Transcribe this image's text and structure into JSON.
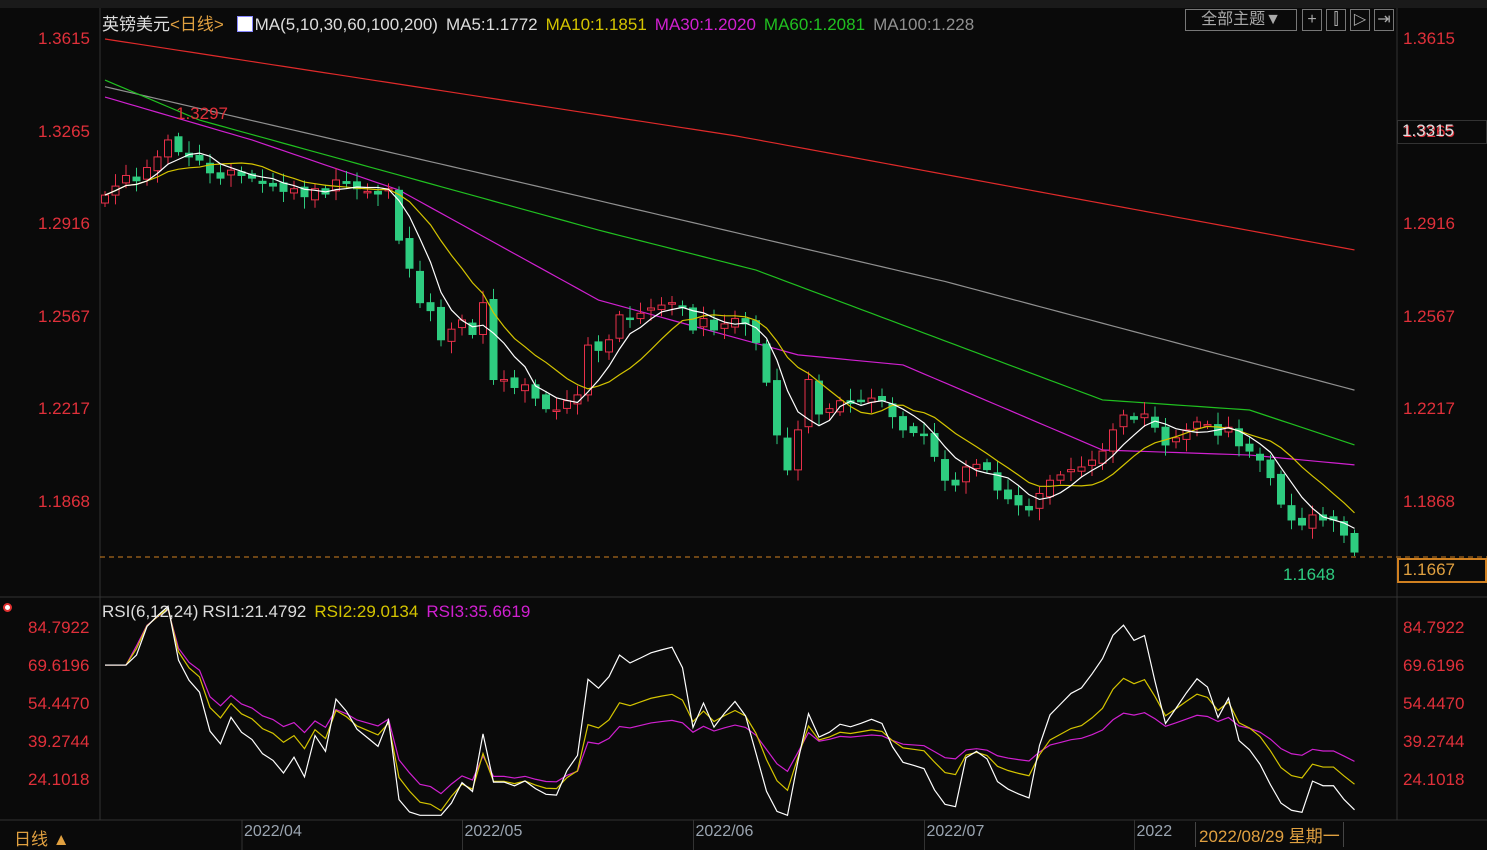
{
  "header": {
    "symbol": "英镑美元",
    "period": "<日线>",
    "ma_def": "MA(5,10,30,60,100,200)",
    "ma5": "MA5:1.1772",
    "ma10": "MA10:1.1851",
    "ma30": "MA30:1.2020",
    "ma60": "MA60:1.2081",
    "ma100": "MA100:1.228",
    "theme_button": "全部主题▼"
  },
  "rsi_header": {
    "def": "RSI(6,12,24)",
    "rsi1": "RSI1:21.4792",
    "rsi2": "RSI2:29.0134",
    "rsi3": "RSI3:35.6619"
  },
  "footer": {
    "period": "日线 ▲",
    "cursor_date": "2022/08/29 星期一"
  },
  "colors": {
    "up": "#e8304a",
    "down": "#2ecc80",
    "ma5": "#ffffff",
    "ma10": "#d4c400",
    "ma30": "#d020d0",
    "ma60": "#20c020",
    "ma100": "#909090",
    "ma200": "#e02a2a"
  },
  "chart_data": [
    {
      "type": "candlestick",
      "title": "英镑美元 日线",
      "y_ticks": [
        "1.3615",
        "1.3265",
        "1.2916",
        "1.2567",
        "1.2217",
        "1.1868"
      ],
      "y_tick_values": [
        1.3615,
        1.3265,
        1.2916,
        1.2567,
        1.2217,
        1.1868
      ],
      "ylim": [
        1.157,
        1.372
      ],
      "x_ticks": [
        "2022/04",
        "2022/05",
        "2022/06",
        "2022/07",
        "2022"
      ],
      "x_tick_index": [
        14,
        35,
        57,
        79,
        99
      ],
      "high_label": "1.3297",
      "low_label": "1.1648",
      "last_price": "1.1667",
      "cursor_price": "1.3315",
      "close": [
        1.3026,
        1.306,
        1.31,
        1.308,
        1.313,
        1.317,
        1.3234,
        1.319,
        1.317,
        1.3158,
        1.311,
        1.309,
        1.312,
        1.31,
        1.309,
        1.307,
        1.306,
        1.304,
        1.305,
        1.302,
        1.305,
        1.303,
        1.3083,
        1.307,
        1.305,
        1.304,
        1.303,
        1.305,
        1.2856,
        1.275,
        1.262,
        1.259,
        1.248,
        1.252,
        1.2555,
        1.25,
        1.262,
        1.233,
        1.233,
        1.23,
        1.231,
        1.226,
        1.222,
        1.2215,
        1.225,
        1.2272,
        1.246,
        1.244,
        1.248,
        1.2574,
        1.256,
        1.258,
        1.26,
        1.2611,
        1.262,
        1.26,
        1.2517,
        1.256,
        1.2517,
        1.254,
        1.256,
        1.254,
        1.247,
        1.232,
        1.2121,
        1.1989,
        1.214,
        1.233,
        1.22,
        1.222,
        1.225,
        1.224,
        1.225,
        1.226,
        1.225,
        1.219,
        1.214,
        1.213,
        1.212,
        1.204,
        1.195,
        1.1932,
        1.2,
        1.201,
        1.199,
        1.1913,
        1.188,
        1.1857,
        1.1838,
        1.19,
        1.195,
        1.197,
        1.199,
        1.2,
        1.2026,
        1.206,
        1.214,
        1.2196,
        1.218,
        1.22,
        1.215,
        1.2083,
        1.211,
        1.214,
        1.217,
        1.216,
        1.212,
        1.215,
        1.208,
        1.206,
        1.2026,
        1.196,
        1.186,
        1.18,
        1.1781,
        1.1819,
        1.18,
        1.18,
        1.1743,
        1.1679
      ],
      "ma30": [
        [
          0,
          1.3396
        ],
        [
          14,
          1.3234
        ],
        [
          28,
          1.3045
        ],
        [
          47,
          1.263
        ],
        [
          66,
          1.2423
        ],
        [
          76,
          1.2385
        ],
        [
          95,
          1.2064
        ],
        [
          109,
          1.2045
        ],
        [
          119,
          1.2008
        ]
      ],
      "ma60": [
        [
          0,
          1.346
        ],
        [
          9,
          1.3309
        ],
        [
          47,
          1.2894
        ],
        [
          62,
          1.2743
        ],
        [
          95,
          1.2253
        ],
        [
          109,
          1.2215
        ],
        [
          119,
          1.2083
        ]
      ],
      "ma100": [
        [
          0,
          1.3435
        ],
        [
          40,
          1.307
        ],
        [
          80,
          1.27
        ],
        [
          119,
          1.229
        ]
      ],
      "ma200": [
        [
          0,
          1.3615
        ],
        [
          60,
          1.325
        ],
        [
          119,
          1.2819
        ]
      ]
    },
    {
      "type": "line",
      "title": "RSI(6,12,24)",
      "y_ticks": [
        "84.7922",
        "69.6196",
        "54.4470",
        "39.2744",
        "24.1018"
      ],
      "y_tick_values": [
        84.7922,
        69.6196,
        54.447,
        39.2744,
        24.1018
      ],
      "series": [
        "RSI1",
        "RSI2",
        "RSI3"
      ],
      "periods": [
        6,
        12,
        24
      ]
    }
  ]
}
